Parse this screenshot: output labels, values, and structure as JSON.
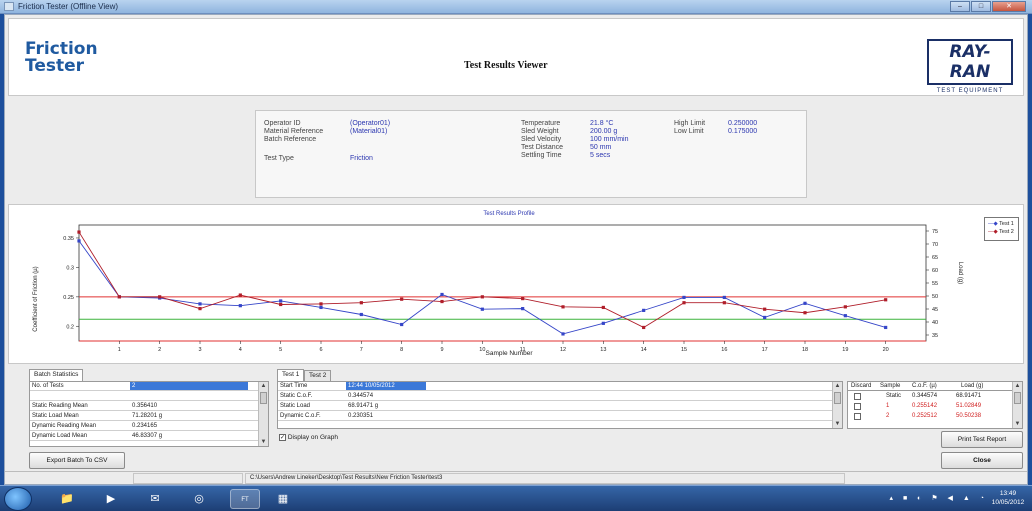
{
  "window": {
    "title": "Friction Tester (Offline View)",
    "min": "–",
    "max": "□",
    "close": "✕"
  },
  "header": {
    "logo_line1": "Friction",
    "logo_line2": "Tester",
    "title": "Test Results Viewer",
    "brand": "RAY-RAN",
    "brand_sub": "TEST EQUIPMENT"
  },
  "info": {
    "operator_id_label": "Operator ID",
    "operator_id": "(Operator01)",
    "material_ref_label": "Material Reference",
    "material_ref": "(Material01)",
    "batch_ref_label": "Batch Reference",
    "batch_ref": "",
    "test_type_label": "Test Type",
    "test_type": "Friction",
    "temperature_label": "Temperature",
    "temperature": "21.8 °C",
    "sled_weight_label": "Sled Weight",
    "sled_weight": "200.00 g",
    "sled_velocity_label": "Sled Velocity",
    "sled_velocity": "100 mm/min",
    "test_distance_label": "Test Distance",
    "test_distance": "50 mm",
    "settling_time_label": "Settling Time",
    "settling_time": "5 secs",
    "high_limit_label": "High Limit",
    "high_limit": "0.250000",
    "low_limit_label": "Low Limit",
    "low_limit": "0.175000"
  },
  "chart_data": {
    "type": "line",
    "title": "Test Results Profile",
    "xlabel": "Sample Number",
    "ylabel": "Coefficient of Friction (µ)",
    "y2label": "Load (g)",
    "x": [
      1,
      2,
      3,
      4,
      5,
      6,
      7,
      8,
      9,
      10,
      11,
      12,
      13,
      14,
      15,
      16,
      17,
      18,
      19,
      20
    ],
    "xlim": [
      0,
      21
    ],
    "ylim": [
      0.175,
      0.372
    ],
    "yticks": [
      "0.2",
      "0.25",
      "0.3",
      "0.35"
    ],
    "y2ticks": [
      "35",
      "40",
      "45",
      "50",
      "55",
      "60",
      "65",
      "70",
      "75"
    ],
    "series": [
      {
        "name": "Test 1",
        "color": "#3545c8",
        "values": [
          0.345,
          0.25,
          0.248,
          0.238,
          0.235,
          0.243,
          0.232,
          0.22,
          0.203,
          0.254,
          0.229,
          0.23,
          0.187,
          0.205,
          0.227,
          0.249,
          0.249,
          0.215,
          0.239,
          0.218,
          0.198
        ]
      },
      {
        "name": "Test 2",
        "color": "#b01e2a",
        "values": [
          0.36,
          0.25,
          0.25,
          0.23,
          0.253,
          0.237,
          0.238,
          0.24,
          0.246,
          0.242,
          0.25,
          0.247,
          0.233,
          0.232,
          0.198,
          0.24,
          0.24,
          0.229,
          0.223,
          0.233,
          0.245
        ]
      }
    ],
    "reference_lines": [
      {
        "value": 0.25,
        "color": "#e03030"
      },
      {
        "value": 0.212,
        "color": "#3cb43c"
      },
      {
        "value": 0.175,
        "color": "#e03030"
      }
    ],
    "grid": false,
    "legend": "top-right"
  },
  "batch": {
    "tab": "Batch Statistics",
    "rows": [
      {
        "label": "No. of Tests",
        "value": "2"
      },
      {
        "label": "",
        "value": ""
      },
      {
        "label": "Static Reading Mean",
        "value": "0.356410"
      },
      {
        "label": "Static Load Mean",
        "value": "71.28201 g"
      },
      {
        "label": "Dynamic Reading Mean",
        "value": "0.234165"
      },
      {
        "label": "Dynamic Load Mean",
        "value": "46.83307 g"
      }
    ],
    "export_button": "Export Batch To CSV"
  },
  "test": {
    "tabs": [
      "Test 1",
      "Test 2"
    ],
    "rows": [
      {
        "label": "Start Time",
        "value": "12:44 10/05/2012"
      },
      {
        "label": "Static C.o.F.",
        "value": "0.344574"
      },
      {
        "label": "Static Load",
        "value": "68.91471 g"
      },
      {
        "label": "Dynamic C.o.F.",
        "value": "0.230351"
      }
    ],
    "display_on_graph": "Display on Graph"
  },
  "results": {
    "headers": [
      "Discard",
      "Sample",
      "C.o.F. (µ)",
      "Load (g)"
    ],
    "rows": [
      {
        "sample": "Static",
        "cof": "0.344574",
        "load": "68.91471",
        "color": "#222222"
      },
      {
        "sample": "1",
        "cof": "0.255142",
        "load": "51.02849",
        "color": "#d02020"
      },
      {
        "sample": "2",
        "cof": "0.252512",
        "load": "50.50238",
        "color": "#d02020"
      }
    ],
    "print_button": "Print Test Report",
    "close_button": "Close"
  },
  "status": {
    "path": "C:\\Users\\Andrew Lineker\\Desktop\\Test Results\\New Friction Tester\\test3"
  },
  "taskbar": {
    "time": "13:49",
    "date": "10/05/2012"
  }
}
